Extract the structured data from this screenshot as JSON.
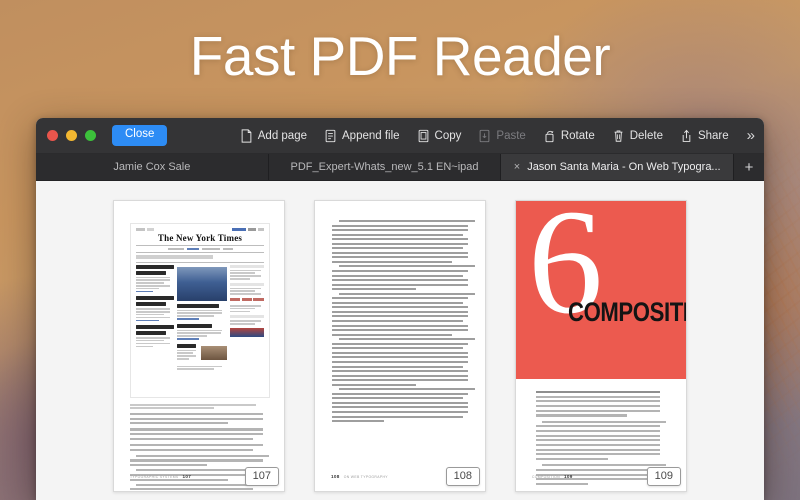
{
  "hero": {
    "title": "Fast PDF Reader"
  },
  "window": {
    "traffic_lights": [
      {
        "name": "close",
        "color": "#e9554c"
      },
      {
        "name": "minimize",
        "color": "#f2b731"
      },
      {
        "name": "zoom",
        "color": "#3cc13b"
      }
    ],
    "toolbar": {
      "close_label": "Close",
      "overflow_label": "»",
      "items": [
        {
          "label": "Add page",
          "icon": "add-page-icon",
          "enabled": true
        },
        {
          "label": "Append file",
          "icon": "append-file-icon",
          "enabled": true
        },
        {
          "label": "Copy",
          "icon": "copy-icon",
          "enabled": true
        },
        {
          "label": "Paste",
          "icon": "paste-icon",
          "enabled": false
        },
        {
          "label": "Rotate",
          "icon": "rotate-icon",
          "enabled": true
        },
        {
          "label": "Delete",
          "icon": "delete-icon",
          "enabled": true
        },
        {
          "label": "Share",
          "icon": "share-icon",
          "enabled": true
        }
      ]
    },
    "tabs": [
      {
        "label": "Jamie Cox Sale",
        "active": false,
        "closable": false
      },
      {
        "label": "PDF_Expert-Whats_new_5.1 EN~ipad",
        "active": false,
        "closable": false
      },
      {
        "label": "Jason Santa Maria - On Web Typogra...",
        "active": true,
        "closable": true,
        "close_label": "×"
      }
    ],
    "new_tab_label": "+",
    "pages": [
      {
        "page_number": "107",
        "kind": "screenshot-page",
        "footer_left": "Typographic Systems",
        "footer_number": "107",
        "masthead": "The New York Times"
      },
      {
        "page_number": "108",
        "kind": "text-page",
        "footer_number": "108",
        "footer_right": "On Web Typography"
      },
      {
        "page_number": "109",
        "kind": "chapter-opener",
        "chapter_number": "6",
        "chapter_title": "COMPOSITION",
        "footer_left": "Composition",
        "footer_number": "109",
        "accent_color": "#ec5a4f"
      }
    ]
  }
}
